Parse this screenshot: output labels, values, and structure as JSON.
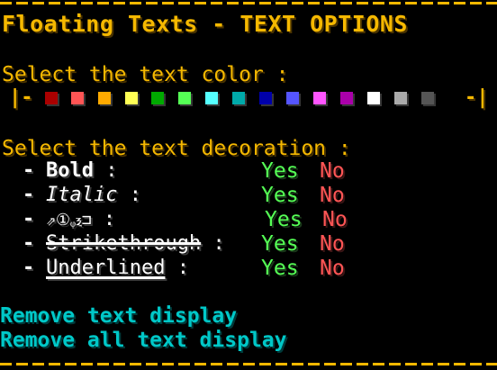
{
  "title": "Floating Texts - TEXT OPTIONS",
  "color_section": {
    "label": "Select the text color :",
    "left_bracket": "|-",
    "right_bracket": "-|",
    "swatches": [
      {
        "name": "dark-red",
        "color": "#aa0000"
      },
      {
        "name": "red",
        "color": "#ff5555"
      },
      {
        "name": "gold",
        "color": "#ffaa00"
      },
      {
        "name": "yellow",
        "color": "#ffff55"
      },
      {
        "name": "dark-green",
        "color": "#00aa00"
      },
      {
        "name": "green",
        "color": "#55ff55"
      },
      {
        "name": "aqua",
        "color": "#55ffff"
      },
      {
        "name": "dark-aqua",
        "color": "#00aaaa"
      },
      {
        "name": "dark-blue",
        "color": "#0000aa"
      },
      {
        "name": "blue",
        "color": "#5555ff"
      },
      {
        "name": "light-purple",
        "color": "#ff55ff"
      },
      {
        "name": "dark-purple",
        "color": "#aa00aa"
      },
      {
        "name": "white",
        "color": "#ffffff"
      },
      {
        "name": "gray",
        "color": "#aaaaaa"
      },
      {
        "name": "dark-gray",
        "color": "#555555"
      }
    ]
  },
  "decoration_section": {
    "label": "Select the text decoration :",
    "dash": "-",
    "colon": ":",
    "yes_label": "Yes",
    "no_label": "No",
    "options": [
      {
        "label": "Bold"
      },
      {
        "label": "Italic"
      },
      {
        "label": "⇗①ᵩⲝ⊐"
      },
      {
        "label": "Strikethrough"
      },
      {
        "label": "Underlined"
      }
    ]
  },
  "actions": {
    "remove_text": "Remove text display",
    "remove_all": "Remove all text display"
  },
  "colors": {
    "accent": "#f5b800",
    "yes": "#55ff55",
    "no": "#ff5555",
    "action": "#00c8c8"
  }
}
